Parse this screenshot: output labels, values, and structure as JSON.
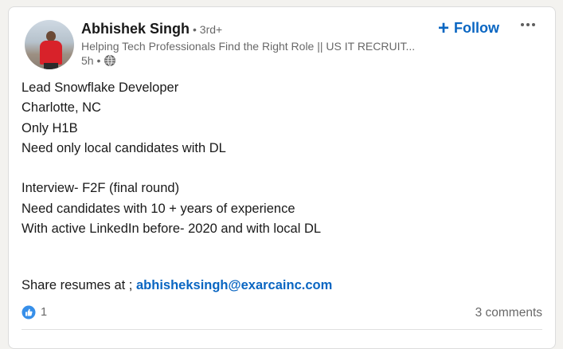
{
  "post": {
    "author": {
      "name": "Abhishek Singh",
      "degree": "• 3rd+",
      "headline": "Helping Tech Professionals Find the Right Role || US IT RECRUIT...",
      "time": "5h •",
      "visibility_icon": "globe-icon"
    },
    "follow_label": "Follow",
    "more_icon": "ellipsis-icon",
    "body_lines": [
      "Lead Snowflake Developer",
      "Charlotte, NC",
      "Only H1B",
      "Need only local candidates with DL",
      "",
      "Interview- F2F (final round)",
      "Need candidates with 10 + years of experience",
      "With active LinkedIn before- 2020 and with local DL"
    ],
    "share_prefix": "Share resumes at ; ",
    "share_email": "abhisheksingh@exarcainc.com",
    "reactions_count": "1",
    "comments_label": "3 comments",
    "colors": {
      "link": "#0a66c2",
      "like": "#378fe9"
    }
  }
}
